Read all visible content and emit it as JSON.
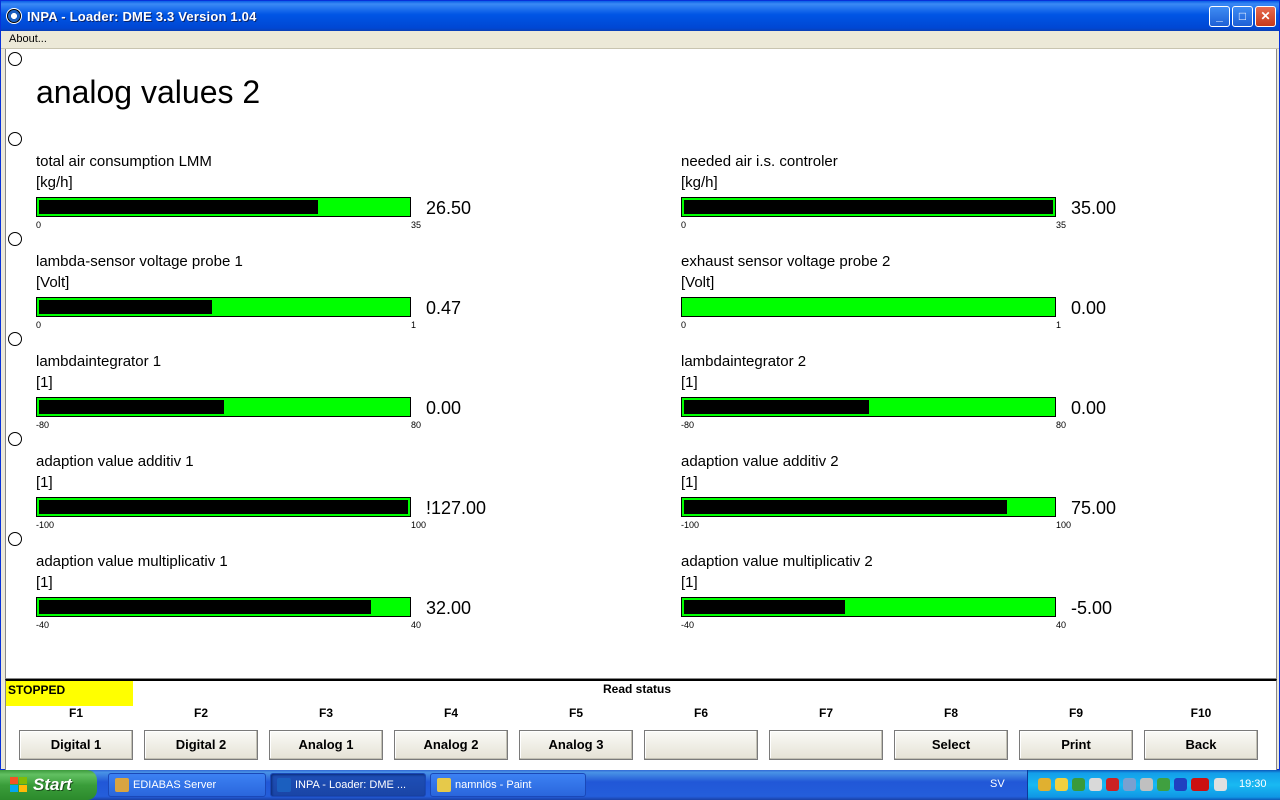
{
  "window": {
    "title": "INPA - Loader:  DME 3.3 Version 1.04"
  },
  "menu": {
    "about": "About..."
  },
  "page_title": "analog values 2",
  "gauges_left": [
    {
      "label": "total air consumption LMM",
      "unit": "[kg/h]",
      "min": "0",
      "max": "35",
      "value": "26.50",
      "fill": 0.757
    },
    {
      "label": "lambda-sensor voltage probe 1",
      "unit": "[Volt]",
      "min": "0",
      "max": "1",
      "value": "0.47",
      "fill": 0.47
    },
    {
      "label": "lambdaintegrator 1",
      "unit": "[1]",
      "min": "-80",
      "max": "80",
      "value": "0.00",
      "fill": 0.5
    },
    {
      "label": "adaption value additiv 1",
      "unit": "[1]",
      "min": "-100",
      "max": "100",
      "value": "!127.00",
      "fill": 1.0
    },
    {
      "label": "adaption value multiplicativ 1",
      "unit": "[1]",
      "min": "-40",
      "max": "40",
      "value": "32.00",
      "fill": 0.9
    }
  ],
  "gauges_right": [
    {
      "label": "needed air i.s. controler",
      "unit": "[kg/h]",
      "min": "0",
      "max": "35",
      "value": "35.00",
      "fill": 1.0
    },
    {
      "label": "exhaust sensor voltage probe 2",
      "unit": "[Volt]",
      "min": "0",
      "max": "1",
      "value": "0.00",
      "fill": 0.0
    },
    {
      "label": "lambdaintegrator 2",
      "unit": "[1]",
      "min": "-80",
      "max": "80",
      "value": "0.00",
      "fill": 0.5
    },
    {
      "label": "adaption value additiv 2",
      "unit": "[1]",
      "min": "-100",
      "max": "100",
      "value": "75.00",
      "fill": 0.875
    },
    {
      "label": "adaption value multiplicativ 2",
      "unit": "[1]",
      "min": "-40",
      "max": "40",
      "value": "-5.00",
      "fill": 0.4375
    }
  ],
  "status": {
    "state": "STOPPED",
    "caption": "Read status"
  },
  "function_keys": [
    {
      "key": "F1",
      "label": "Digital 1"
    },
    {
      "key": "F2",
      "label": "Digital 2"
    },
    {
      "key": "F3",
      "label": "Analog 1"
    },
    {
      "key": "F4",
      "label": "Analog 2"
    },
    {
      "key": "F5",
      "label": "Analog 3"
    },
    {
      "key": "F6",
      "label": ""
    },
    {
      "key": "F7",
      "label": ""
    },
    {
      "key": "F8",
      "label": "Select"
    },
    {
      "key": "F9",
      "label": "Print"
    },
    {
      "key": "F10",
      "label": "Back"
    }
  ],
  "taskbar": {
    "start": "Start",
    "tasks": [
      {
        "label": "EDIABAS Server",
        "icon": "ediabas-icon"
      },
      {
        "label": "INPA - Loader:  DME ...",
        "icon": "bmw-icon"
      },
      {
        "label": "namnlös - Paint",
        "icon": "paint-icon"
      }
    ],
    "language": "SV",
    "clock": "19:30"
  },
  "colors": {
    "bar_green": "#00ff00",
    "bar_fill": "#000000",
    "status_yellow": "#ffff00"
  }
}
